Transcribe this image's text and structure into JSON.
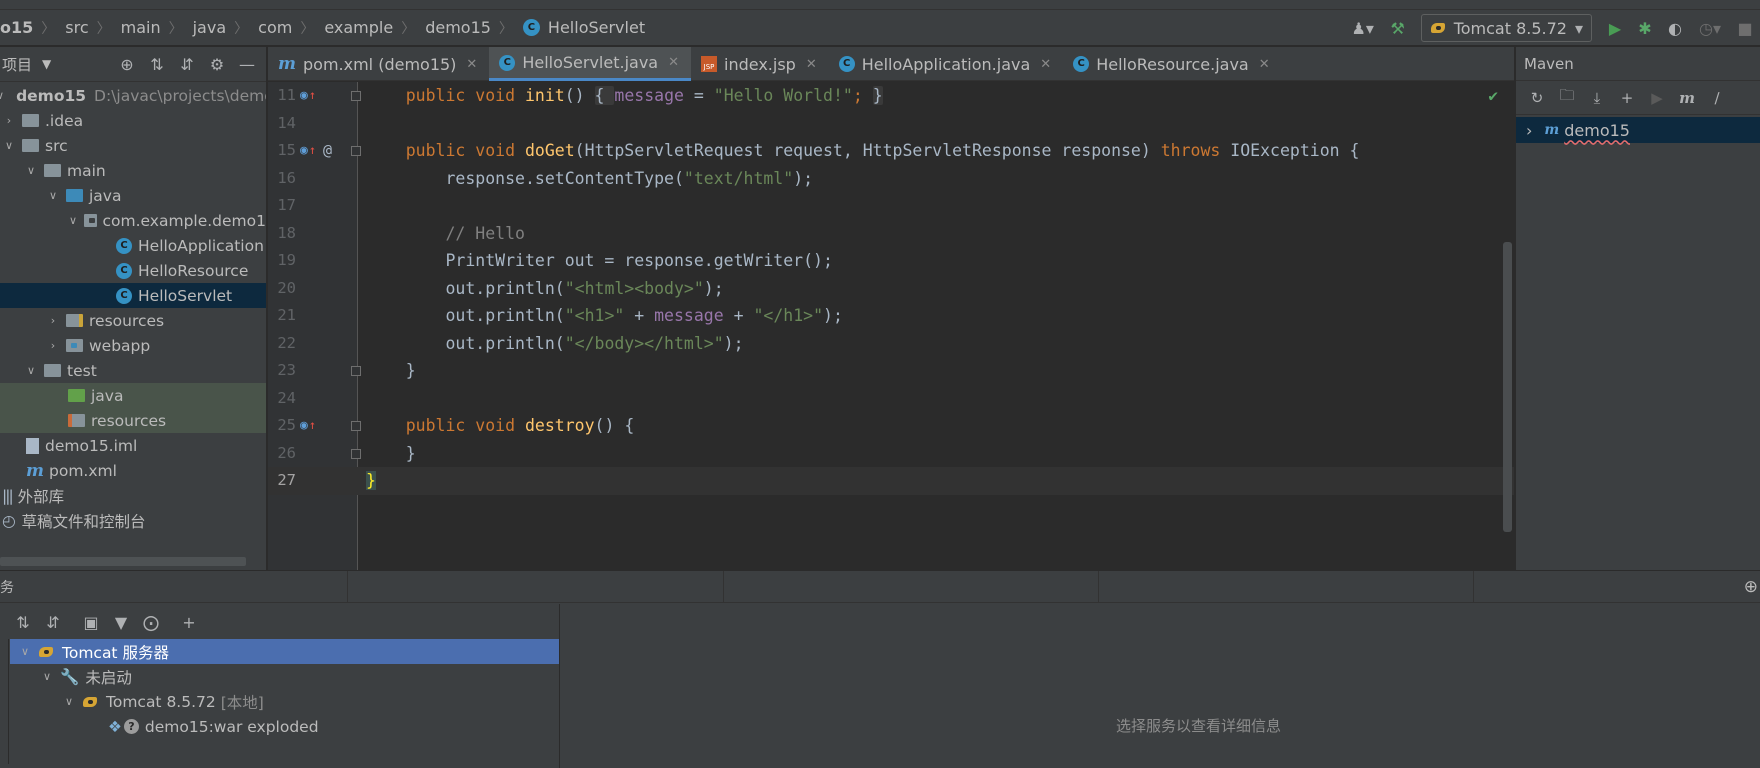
{
  "breadcrumb": {
    "items": [
      "o15",
      "src",
      "main",
      "java",
      "com",
      "example",
      "demo15",
      "HelloServlet"
    ]
  },
  "run_config": {
    "label": "Tomcat 8.5.72"
  },
  "project": {
    "title": "项目",
    "tree": [
      {
        "label": "demo15",
        "hint": "D:\\javac\\projects\\demo"
      },
      {
        "label": ".idea"
      },
      {
        "label": "src"
      },
      {
        "label": "main"
      },
      {
        "label": "java"
      },
      {
        "label": "com.example.demo1"
      },
      {
        "label": "HelloApplication"
      },
      {
        "label": "HelloResource"
      },
      {
        "label": "HelloServlet"
      },
      {
        "label": "resources"
      },
      {
        "label": "webapp"
      },
      {
        "label": "test"
      },
      {
        "label": "java"
      },
      {
        "label": "resources"
      },
      {
        "label": "demo15.iml"
      },
      {
        "label": "pom.xml"
      },
      {
        "label": "外部库"
      },
      {
        "label": "草稿文件和控制台"
      }
    ]
  },
  "tabs": [
    {
      "label": "pom.xml (demo15)",
      "icon": "maven-icon"
    },
    {
      "label": "HelloServlet.java",
      "icon": "class-icon",
      "active": true
    },
    {
      "label": "index.jsp",
      "icon": "jsp-icon"
    },
    {
      "label": "HelloApplication.java",
      "icon": "class-icon"
    },
    {
      "label": "HelloResource.java",
      "icon": "class-icon"
    }
  ],
  "editor": {
    "line_numbers": [
      "11",
      "14",
      "15",
      "16",
      "17",
      "18",
      "19",
      "20",
      "21",
      "22",
      "23",
      "24",
      "25",
      "26",
      "27"
    ],
    "lines": {
      "l11": {
        "kw1": "public ",
        "kw2": "void ",
        "fn": "init",
        "p1": "() ",
        "b1": "{ ",
        "fld": "message",
        "p2": " = ",
        "str": "\"Hello World!\"",
        "p3": "; ",
        "b2": "}"
      },
      "l15": {
        "kw1": "public ",
        "kw2": "void ",
        "fn": "doGet",
        "p1": "(HttpServletRequest request, HttpServletResponse response) ",
        "kw3": "throws",
        "p2": " IOException {"
      },
      "l16": {
        "p1": "response.setContentType(",
        "str": "\"text/html\"",
        "p2": ");"
      },
      "l18": {
        "cmt": "// Hello"
      },
      "l19": {
        "p1": "PrintWriter out = response.getWriter();"
      },
      "l20": {
        "p1": "out.println(",
        "str": "\"<html><body>\"",
        "p2": ");"
      },
      "l21": {
        "p1": "out.println(",
        "str1": "\"<h1>\"",
        "p2": " + ",
        "fld": "message",
        "p3": " + ",
        "str2": "\"</h1>\"",
        "p4": ");"
      },
      "l22": {
        "p1": "out.println(",
        "str": "\"</body></html>\"",
        "p2": ");"
      },
      "l23": {
        "p1": "}"
      },
      "l25": {
        "kw1": "public ",
        "kw2": "void ",
        "fn": "destroy",
        "p1": "() {"
      },
      "l26": {
        "p1": "}"
      },
      "l27": {
        "p1": "}"
      }
    },
    "annotation_at": "@"
  },
  "maven": {
    "title": "Maven",
    "project": "demo15"
  },
  "services": {
    "header_char": "务",
    "tree": [
      {
        "label": "Tomcat 服务器"
      },
      {
        "label": "未启动"
      },
      {
        "label": "Tomcat 8.5.72",
        "suffix": "[本地]"
      },
      {
        "label": "demo15:war exploded"
      }
    ],
    "detail_placeholder": "选择服务以查看详细信息"
  },
  "colors": {
    "keyword": "#cc7832",
    "function": "#ffc66d",
    "string": "#6a8759",
    "field": "#9876aa",
    "comment": "#808080",
    "selection": "#0d293e",
    "service_selection": "#4b6eaf"
  }
}
